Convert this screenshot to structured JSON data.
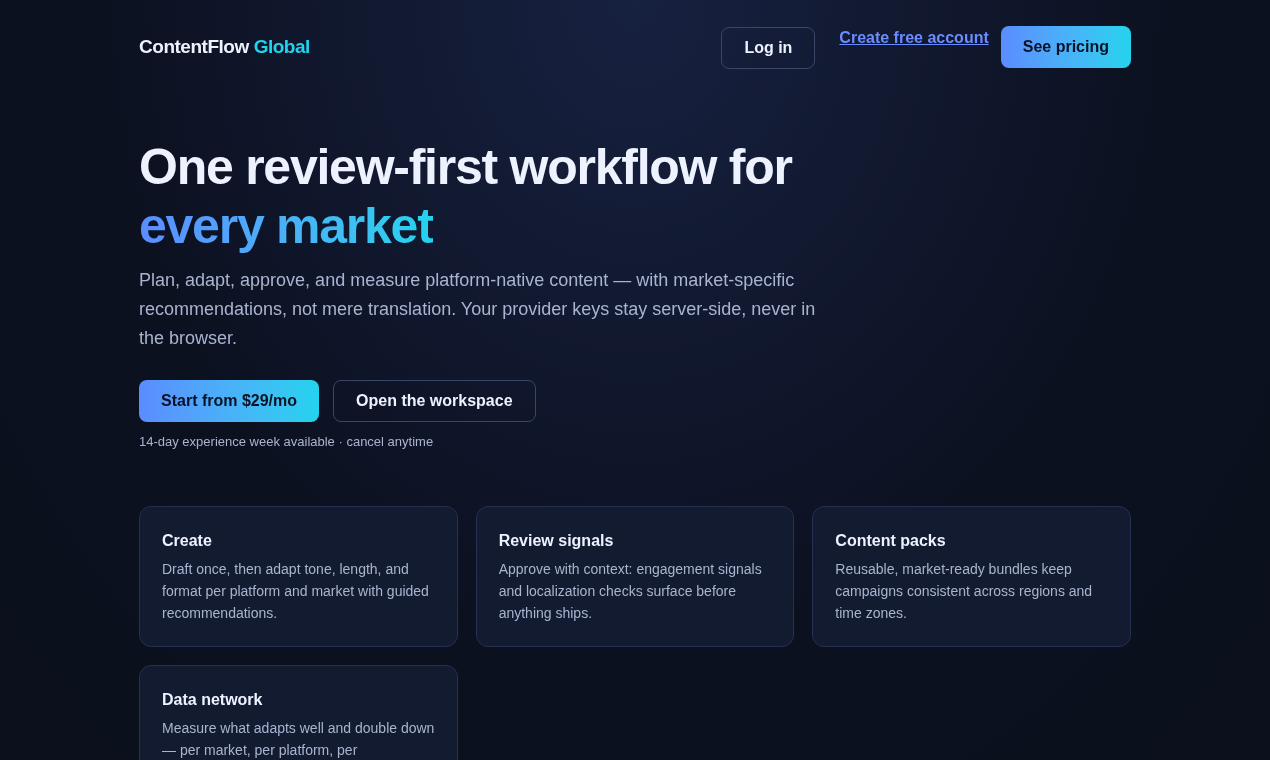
{
  "brand": {
    "name": "ContentFlow",
    "accent": "Global"
  },
  "nav": {
    "login": "Log in",
    "signup_link": "Create free account",
    "pricing": "See pricing"
  },
  "hero": {
    "title": "One review-first workflow for",
    "title_accent": "every market",
    "lead": "Plan, adapt, approve, and measure platform-native content — with market-specific recommendations, not mere translation. Your provider keys stay server-side, never in the browser.",
    "primary_button": "Start from $29/mo",
    "secondary_button": "Open the workspace",
    "note": "14-day experience week available · cancel anytime"
  },
  "features": [
    {
      "title": "Create",
      "text": "Draft once, then adapt tone, length, and format per platform and market with guided recommendations."
    },
    {
      "title": "Review signals",
      "text": "Approve with context: engagement signals and localization checks surface before anything ships."
    },
    {
      "title": "Content packs",
      "text": "Reusable, market-ready bundles keep campaigns consistent across regions and time zones."
    },
    {
      "title": "Data network",
      "text": "Measure what adapts well and double down — per market, per platform, per"
    }
  ]
}
